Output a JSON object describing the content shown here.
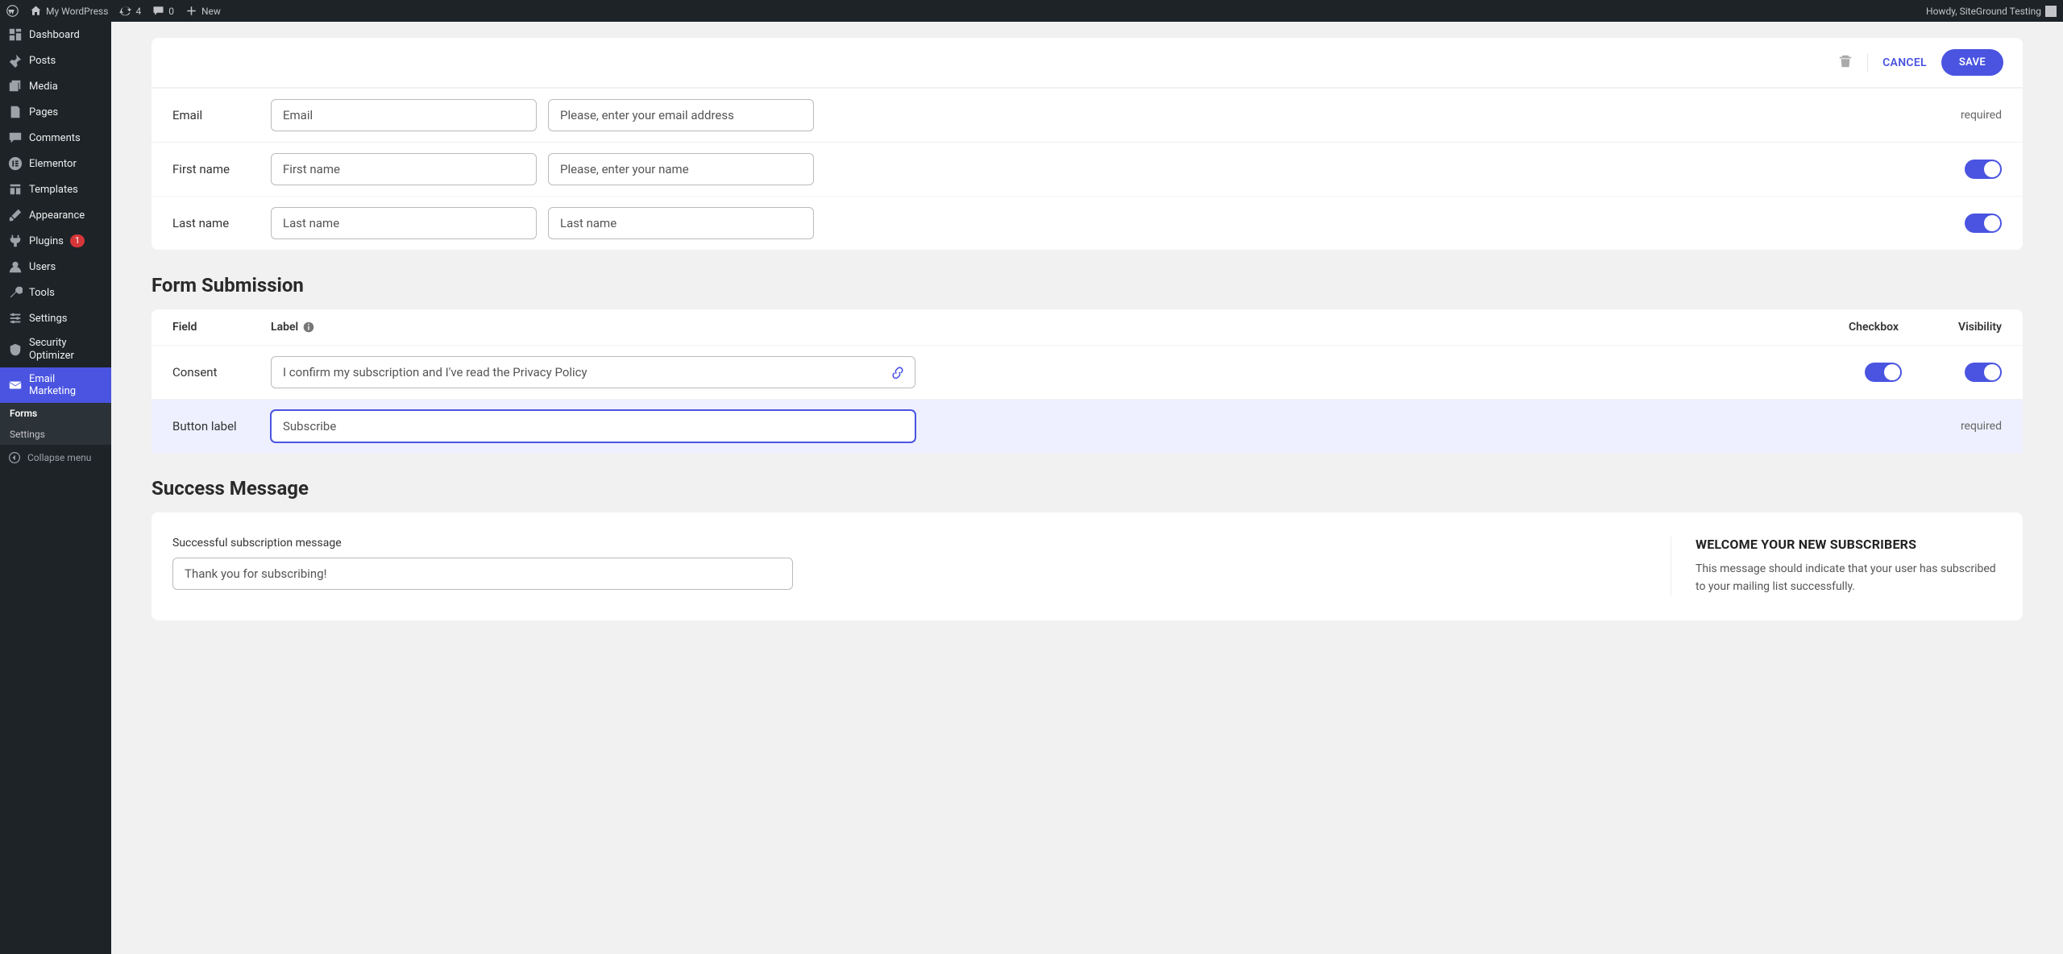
{
  "adminbar": {
    "site": "My WordPress",
    "updates": "4",
    "comments": "0",
    "new": "New",
    "howdy": "Howdy, SiteGround Testing"
  },
  "sidebar": {
    "items": [
      {
        "label": "Dashboard"
      },
      {
        "label": "Posts"
      },
      {
        "label": "Media"
      },
      {
        "label": "Pages"
      },
      {
        "label": "Comments"
      },
      {
        "label": "Elementor"
      },
      {
        "label": "Templates"
      },
      {
        "label": "Appearance"
      },
      {
        "label": "Plugins",
        "badge": "1"
      },
      {
        "label": "Users"
      },
      {
        "label": "Tools"
      },
      {
        "label": "Settings"
      },
      {
        "label": "Security Optimizer"
      },
      {
        "label": "Email Marketing"
      }
    ],
    "submenu": [
      {
        "label": "Forms"
      },
      {
        "label": "Settings"
      }
    ],
    "collapse": "Collapse menu"
  },
  "actions": {
    "cancel": "CANCEL",
    "save": "SAVE"
  },
  "fields": {
    "email": {
      "name": "Email",
      "label": "Email",
      "placeholder": "Please, enter your email address",
      "required": "required"
    },
    "first": {
      "name": "First name",
      "label": "First name",
      "placeholder": "Please, enter your name"
    },
    "last": {
      "name": "Last name",
      "label": "Last name",
      "placeholder": "Last name"
    }
  },
  "submission": {
    "title": "Form Submission",
    "headers": {
      "field": "Field",
      "label": "Label",
      "checkbox": "Checkbox",
      "visibility": "Visibility"
    },
    "consent": {
      "name": "Consent",
      "value": "I confirm my subscription and I've read the Privacy Policy"
    },
    "button": {
      "name": "Button label",
      "value": "Subscribe",
      "required": "required"
    }
  },
  "success": {
    "title": "Success Message",
    "label": "Successful subscription message",
    "value": "Thank you for subscribing!",
    "welcome_title": "WELCOME YOUR NEW SUBSCRIBERS",
    "welcome_text": "This message should indicate that your user has subscribed to your mailing list successfully."
  }
}
